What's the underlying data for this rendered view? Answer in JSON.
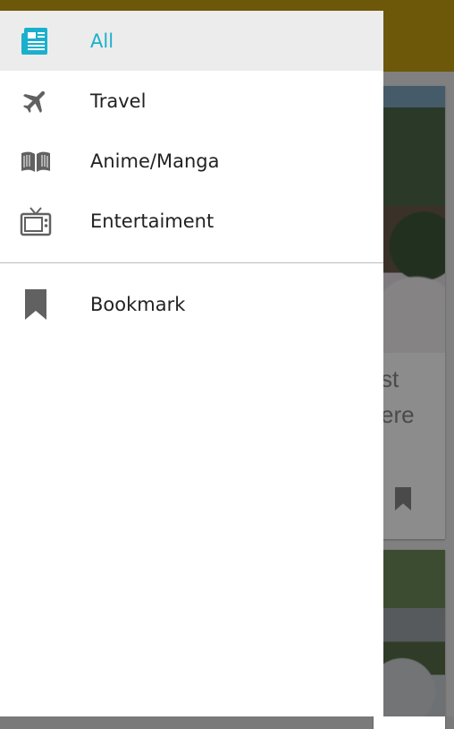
{
  "drawer": {
    "accent_color": "#1ab0cd",
    "items": [
      {
        "label": "All",
        "icon": "newspaper-icon",
        "active": true
      },
      {
        "label": "Travel",
        "icon": "airplane-icon",
        "active": false
      },
      {
        "label": "Anime/Manga",
        "icon": "open-book-icon",
        "active": false
      },
      {
        "label": "Entertaiment",
        "icon": "tv-icon",
        "active": false
      }
    ],
    "secondary_items": [
      {
        "label": "Bookmark",
        "icon": "bookmark-icon"
      }
    ]
  },
  "background": {
    "header_color": "#c79f0f",
    "card1_text_line1": "st",
    "card1_text_line2": "ere"
  }
}
